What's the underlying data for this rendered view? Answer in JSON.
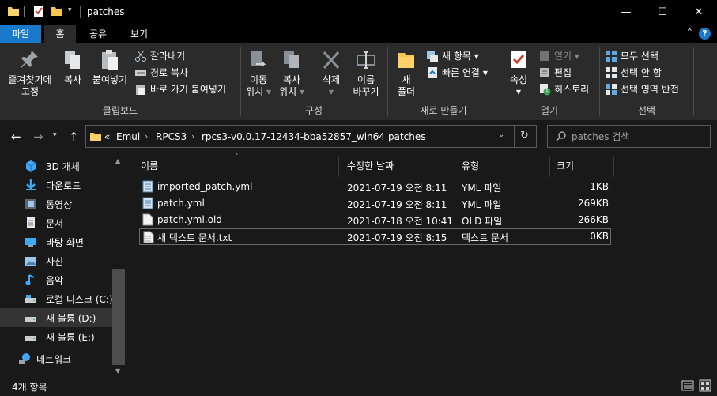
{
  "window": {
    "title": "patches",
    "minimize_glyph": "—",
    "maximize_glyph": "☐",
    "close_glyph": "✕"
  },
  "tabs": {
    "file": "파일",
    "home": "홈",
    "share": "공유",
    "view": "보기"
  },
  "ribbon": {
    "clipboard": {
      "title": "클립보드",
      "pin_line1": "즐겨찾기에",
      "pin_line2": "고정",
      "copy": "복사",
      "paste": "붙여넣기",
      "cut": "잘라내기",
      "copy_path": "경로 복사",
      "paste_shortcut": "바로 가기 붙여넣기"
    },
    "organize": {
      "title": "구성",
      "move_to_line1": "이동",
      "move_to_line2": "위치",
      "copy_to_line1": "복사",
      "copy_to_line2": "위치",
      "delete": "삭제",
      "rename_line1": "이름",
      "rename_line2": "바꾸기"
    },
    "new": {
      "title": "새로 만들기",
      "new_folder_line1": "새",
      "new_folder_line2": "폴더",
      "new_item": "새 항목",
      "easy_access": "빠른 연결"
    },
    "open": {
      "title": "열기",
      "properties": "속성",
      "open": "열기",
      "edit": "편집",
      "history": "히스토리"
    },
    "select": {
      "title": "선택",
      "select_all": "모두 선택",
      "select_none": "선택 안 함",
      "invert": "선택 영역 반전"
    }
  },
  "address": {
    "overflow": "«",
    "crumbs": [
      "Emul",
      "RPCS3",
      "rpcs3-v0.0.17-12434-bba52857_win64",
      "patches"
    ]
  },
  "search": {
    "placeholder": "patches 검색"
  },
  "sidebar": {
    "items": [
      {
        "label": "3D 개체",
        "icon": "3d-objects-icon"
      },
      {
        "label": "다운로드",
        "icon": "downloads-icon"
      },
      {
        "label": "동영상",
        "icon": "videos-icon"
      },
      {
        "label": "문서",
        "icon": "documents-icon"
      },
      {
        "label": "바탕 화면",
        "icon": "desktop-icon"
      },
      {
        "label": "사진",
        "icon": "pictures-icon"
      },
      {
        "label": "음악",
        "icon": "music-icon"
      },
      {
        "label": "로컬 디스크 (C:)",
        "icon": "local-disk-icon"
      },
      {
        "label": "새 볼륨 (D:)",
        "icon": "drive-icon"
      },
      {
        "label": "새 볼륨 (E:)",
        "icon": "drive-icon"
      },
      {
        "label": "네트워크",
        "icon": "network-icon"
      }
    ]
  },
  "filelist": {
    "columns": {
      "name": "이름",
      "date": "수정한 날짜",
      "type": "유형",
      "size": "크기"
    },
    "rows": [
      {
        "name": "imported_patch.yml",
        "date": "2021-07-19 오전 8:11",
        "type": "YML 파일",
        "size": "1KB",
        "icon": "yml-file-icon"
      },
      {
        "name": "patch.yml",
        "date": "2021-07-19 오전 8:11",
        "type": "YML 파일",
        "size": "269KB",
        "icon": "yml-file-icon"
      },
      {
        "name": "patch.yml.old",
        "date": "2021-07-18 오전 10:41",
        "type": "OLD 파일",
        "size": "266KB",
        "icon": "file-icon"
      },
      {
        "name": "새 텍스트 문서.txt",
        "date": "2021-07-19 오전 8:15",
        "type": "텍스트 문서",
        "size": "0KB",
        "icon": "text-file-icon"
      }
    ]
  },
  "status": {
    "item_count": "4개 항목"
  },
  "colors": {
    "accent": "#1979ca",
    "background": "#191919",
    "ribbon": "#2b2b2b",
    "titlebar": "#000000",
    "folder": "#f8c64c"
  }
}
